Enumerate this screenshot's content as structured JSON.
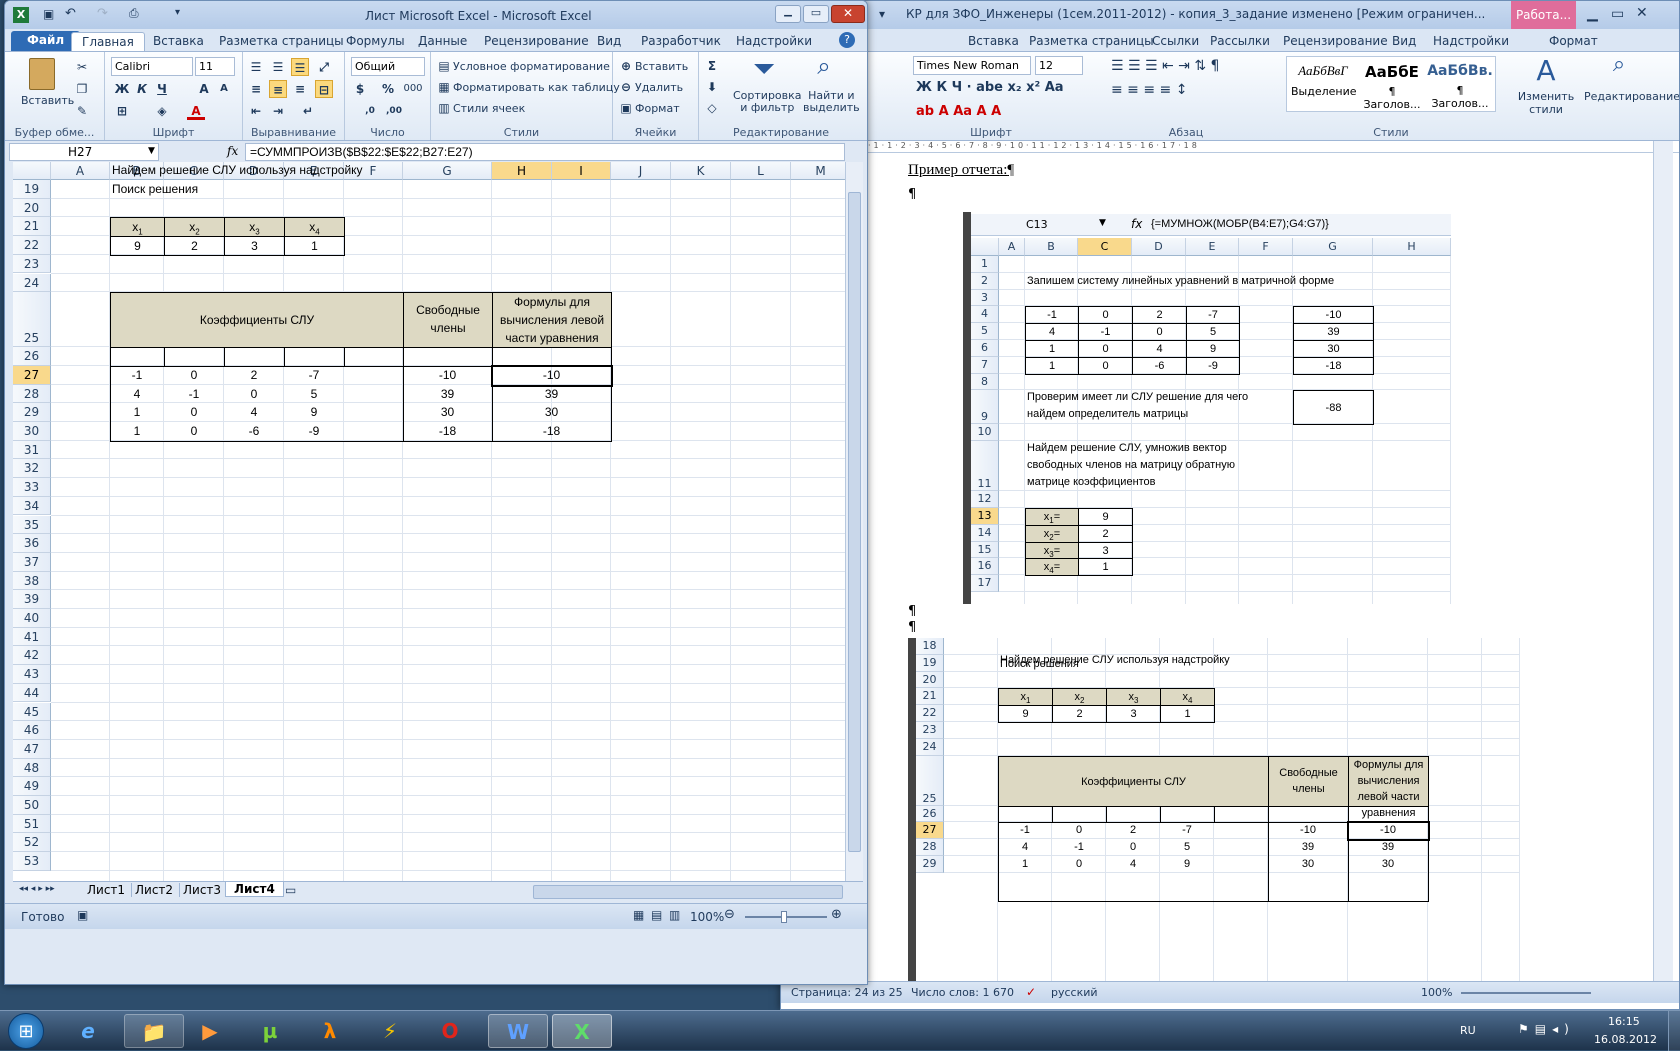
{
  "excel": {
    "title": "Лист Microsoft Excel  -  Microsoft Excel",
    "tabs": [
      "Файл",
      "Главная",
      "Вставка",
      "Разметка страницы",
      "Формулы",
      "Данные",
      "Рецензирование",
      "Вид",
      "Разработчик",
      "Надстройки"
    ],
    "ribbon": {
      "paste": "Вставить",
      "clipboard": "Буфер обме...",
      "font_group": "Шрифт",
      "font_name": "Calibri",
      "font_size": "11",
      "bold": "Ж",
      "italic": "К",
      "underline": "Ч",
      "align_group": "Выравнивание",
      "number_format": "Общий",
      "number_group": "Число",
      "percent": "%",
      "thousands": "000",
      "cond_format": "Условное форматирование",
      "format_table": "Форматировать как таблицу",
      "cell_styles": "Стили ячеек",
      "styles_group": "Стили",
      "insert": "Вставить",
      "delete": "Удалить",
      "format": "Формат",
      "cells_group": "Ячейки",
      "sort": "Сортировка\nи фильтр",
      "find": "Найти и\nвыделить",
      "editing_group": "Редактирование"
    },
    "name_box": "H27",
    "fx": "fx",
    "formula": "=СУММПРОИЗВ($B$22:$E$22;B27:E27)",
    "columns": [
      "A",
      "B",
      "C",
      "D",
      "E",
      "F",
      "G",
      "H",
      "I",
      "J",
      "K",
      "L",
      "M"
    ],
    "rows": [
      "19",
      "20",
      "21",
      "22",
      "23",
      "24",
      "25",
      "26",
      "27",
      "28",
      "29",
      "30",
      "31",
      "32",
      "33",
      "34",
      "35",
      "36",
      "37",
      "38",
      "39",
      "40",
      "41",
      "42",
      "43",
      "44",
      "45",
      "46",
      "47",
      "48",
      "49",
      "50",
      "51",
      "52",
      "53"
    ],
    "text_line1": "Найдем решение СЛУ используя надстройку",
    "text_line2": "Поиск решения",
    "x_headers": [
      "x",
      "x",
      "x",
      "x"
    ],
    "x_subs": [
      "1",
      "2",
      "3",
      "4"
    ],
    "x_values": [
      "9",
      "2",
      "3",
      "1"
    ],
    "coef_title": "Коэффициенты СЛУ",
    "free_title": "Свободные члены",
    "formula_title": "Формулы для вычисления левой части уравнения",
    "matrix": [
      [
        "-1",
        "0",
        "2",
        "-7"
      ],
      [
        "4",
        "-1",
        "0",
        "5"
      ],
      [
        "1",
        "0",
        "4",
        "9"
      ],
      [
        "1",
        "0",
        "-6",
        "-9"
      ]
    ],
    "free": [
      "-10",
      "39",
      "30",
      "-18"
    ],
    "results": [
      "-10",
      "39",
      "30",
      "-18"
    ],
    "sheets": [
      "Лист1",
      "Лист2",
      "Лист3",
      "Лист4"
    ],
    "status": "Готово",
    "zoom": "100%"
  },
  "word": {
    "title": "КР для ЗФО_Инженеры (1сем.2011-2012) - копия_3_задание изменено [Режим ограничен...",
    "context_tab": "Работа...",
    "tabs": [
      "Вставка",
      "Разметка страницы",
      "Ссылки",
      "Рассылки",
      "Рецензирование",
      "Вид",
      "Надстройки",
      "Формат"
    ],
    "font_name": "Times New Roman",
    "font_size": "12",
    "groups": [
      "Шрифт",
      "Абзац",
      "Стили",
      "Редактирование"
    ],
    "styles": [
      {
        "sample": "АаБбВвГ",
        "name": "Выделение"
      },
      {
        "sample": "АаБбЕ",
        "name": "¶ Заголов..."
      },
      {
        "sample": "АаБбВв.",
        "name": "¶ Заголов..."
      }
    ],
    "change_styles": "Изменить стили",
    "editing": "Редактирование",
    "heading": "Пример отчета:",
    "pilcrow": "¶",
    "img1": {
      "name_box": "C13",
      "formula": "{=МУМНОЖ(МОБР(B4:E7);G4:G7)}",
      "columns": [
        "A",
        "B",
        "C",
        "D",
        "E",
        "F",
        "G",
        "H"
      ],
      "rows": [
        "1",
        "2",
        "3",
        "4",
        "5",
        "6",
        "7",
        "8",
        "9",
        "10",
        "11",
        "12",
        "13",
        "14",
        "15",
        "16",
        "17"
      ],
      "line_matrix": "Запишем  систему линейных уравнений в матричной форме",
      "matrix": [
        [
          "-1",
          "0",
          "2",
          "-7"
        ],
        [
          "4",
          "-1",
          "0",
          "5"
        ],
        [
          "1",
          "0",
          "4",
          "9"
        ],
        [
          "1",
          "0",
          "-6",
          "-9"
        ]
      ],
      "free": [
        "-10",
        "39",
        "30",
        "-18"
      ],
      "check_line1": "Проверим имеет ли СЛУ решение для чего",
      "check_line2": "найдем определитель матрицы",
      "det": "-88",
      "sol_line1": "Найдем решение СЛУ, умножив вектор",
      "sol_line2": "свободных членов на матрицу обратную",
      "sol_line3": "матрице коэффициентов",
      "x_labels": [
        "x",
        "x",
        "x",
        "x"
      ],
      "x_subs": [
        "1",
        "2",
        "3",
        "4"
      ],
      "x_eq": "=",
      "x_values": [
        "9",
        "2",
        "3",
        "1"
      ]
    },
    "img2": {
      "rows": [
        "18",
        "19",
        "20",
        "21",
        "22",
        "23",
        "24",
        "25",
        "26",
        "27",
        "28",
        "29"
      ],
      "text_line1": "Найдем решение СЛУ используя надстройку",
      "text_line2": "Поиск решения",
      "x_values": [
        "9",
        "2",
        "3",
        "1"
      ],
      "coef_title": "Коэффициенты СЛУ",
      "free_title": "Свободные члены",
      "formula_title": "Формулы для вычисления левой части уравнения",
      "matrix": [
        [
          "-1",
          "0",
          "2",
          "-7"
        ],
        [
          "4",
          "-1",
          "0",
          "5"
        ],
        [
          "1",
          "0",
          "4",
          "9"
        ]
      ],
      "free": [
        "-10",
        "39",
        "30"
      ],
      "results": [
        "-10",
        "39",
        "30"
      ]
    },
    "status": {
      "page": "Страница: 24 из 25",
      "words": "Число слов: 1 670",
      "lang": "русский",
      "zoom": "100%"
    }
  },
  "taskbar": {
    "lang": "RU",
    "time": "16:15",
    "date": "16.08.2012"
  }
}
